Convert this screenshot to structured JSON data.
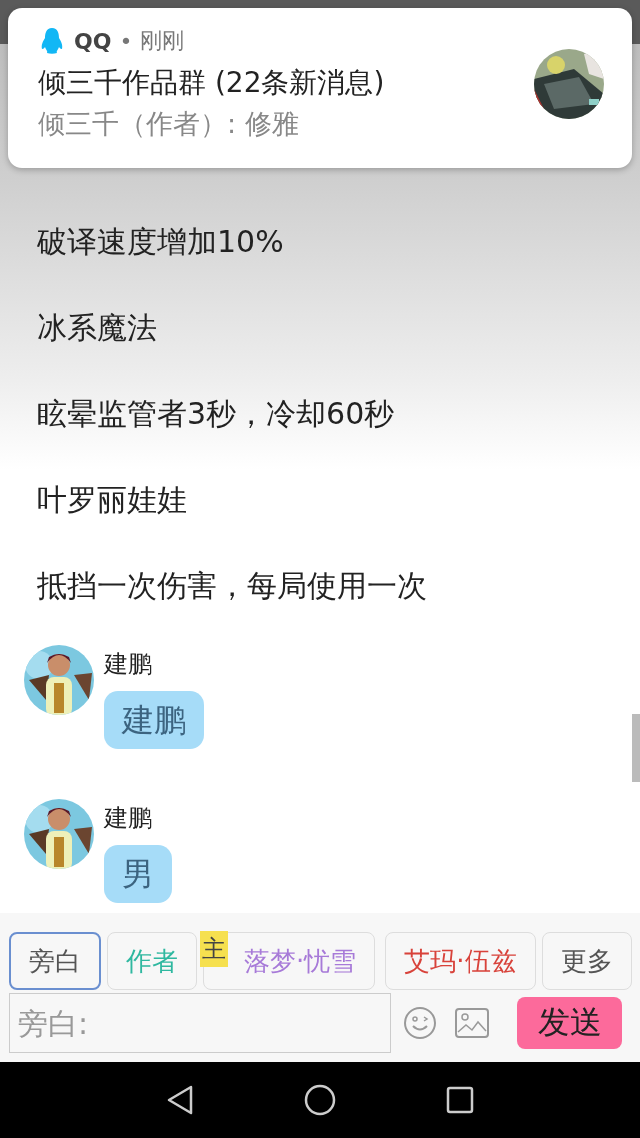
{
  "notification": {
    "app": "QQ",
    "separator": "•",
    "time": "刚刚",
    "title": "倾三千作品群 (22条新消息)",
    "text": "倾三千（作者）: 修雅"
  },
  "narration": [
    "破译速度增加10%",
    "冰系魔法",
    "眩晕监管者3秒，冷却60秒",
    "叶罗丽娃娃",
    "抵挡一次伤害，每局使用一次"
  ],
  "messages": [
    {
      "sender": "建鹏",
      "text": "建鹏"
    },
    {
      "sender": "建鹏",
      "text": "男"
    }
  ],
  "roles": [
    {
      "label": "旁白",
      "color": "#555555",
      "selected": true
    },
    {
      "label": "作者",
      "color": "#2fb8a0",
      "selected": false
    },
    {
      "label": "落梦·忧雪",
      "color": "#a77ad8",
      "selected": false,
      "badge": "主"
    },
    {
      "label": "艾玛·伍兹",
      "color": "#d8423a",
      "selected": false
    },
    {
      "label": "更多",
      "color": "#555555",
      "selected": false
    }
  ],
  "input": {
    "placeholder": "旁白:"
  },
  "send_button": "发送"
}
